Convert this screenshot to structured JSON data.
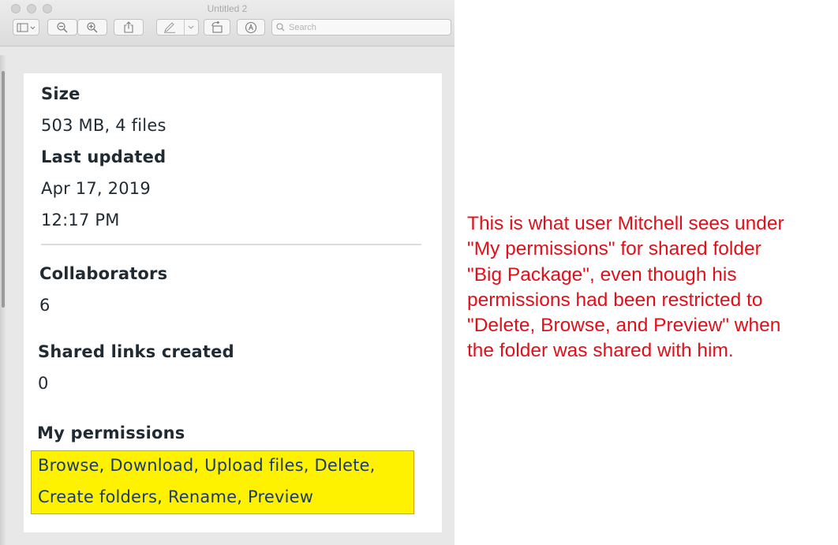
{
  "window": {
    "title": "Untitled 2",
    "search_placeholder": "Search"
  },
  "toolbar": {
    "buttons": [
      {
        "name": "sidebar-toggle-button",
        "icon": "sidebar-icon"
      },
      {
        "name": "zoom-out-button",
        "icon": "zoom-out-icon"
      },
      {
        "name": "zoom-in-button",
        "icon": "zoom-in-icon"
      },
      {
        "name": "share-button",
        "icon": "share-icon"
      },
      {
        "name": "markup-pen-button",
        "icon": "pen-icon"
      },
      {
        "name": "rotate-button",
        "icon": "rotate-icon"
      },
      {
        "name": "markup-toolbar-button",
        "icon": "markup-icon"
      }
    ]
  },
  "details": {
    "size_label": "Size",
    "size_value": "503 MB, 4 files",
    "updated_label": "Last updated",
    "updated_date": "Apr 17, 2019",
    "updated_time": "12:17 PM",
    "collaborators_label": "Collaborators",
    "collaborators_value": "6",
    "shared_links_label": "Shared links created",
    "shared_links_value": "0",
    "permissions_label": "My permissions",
    "permissions_line1": "Browse, Download, Upload files, Delete,",
    "permissions_line2": "Create folders, Rename, Preview"
  },
  "annotation": {
    "lines": [
      "This is what user Mitchell sees under",
      "\"My permissions\" for shared folder",
      "\"Big Package\", even though his",
      "permissions had been restricted to",
      "\"Delete, Browse, and Preview\" when",
      "the folder was shared with him."
    ]
  },
  "colors": {
    "highlight": "#fff200",
    "annotation_text": "#e0101a",
    "card_text": "#1f2a33"
  }
}
